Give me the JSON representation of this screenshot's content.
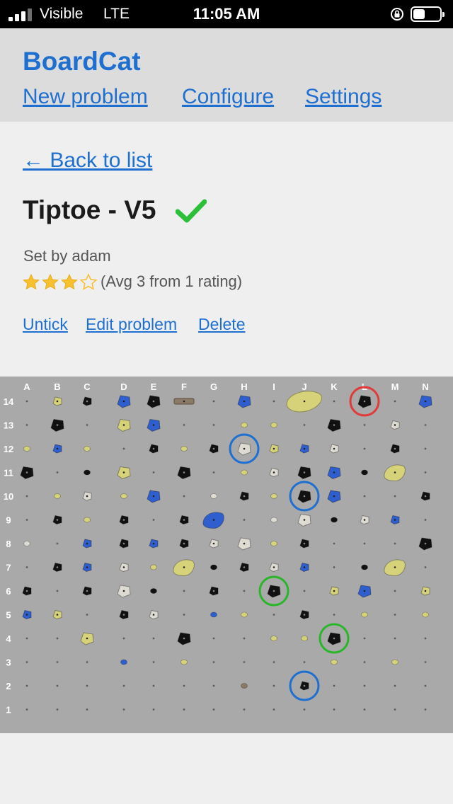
{
  "status_bar": {
    "carrier": "Visible",
    "network": "LTE",
    "time": "11:05 AM"
  },
  "header": {
    "brand": "BoardCat",
    "nav": [
      "New problem",
      "Configure",
      "Settings"
    ]
  },
  "back_link": "← Back to list",
  "problem": {
    "title": "Tiptoe - V5",
    "ticked": true,
    "set_by": "Set by adam",
    "stars_filled": 3,
    "stars_total": 4,
    "rating_text": "(Avg 3 from 1 rating)"
  },
  "actions": [
    "Untick",
    "Edit problem",
    "Delete"
  ],
  "colors": {
    "link": "#1e6fd0",
    "check": "#2bbf3a",
    "star": "#f6c02e",
    "board": "#a9a9a9",
    "hold_black": "#111111",
    "hold_yellow": "#d6d27a",
    "hold_blue": "#2f5fcf",
    "hold_white": "#dedbd2",
    "hold_wood": "#8a7a66",
    "circle_start": "#2bb52b",
    "circle_hand": "#1e6fd0",
    "circle_finish": "#e23a3a"
  },
  "board": {
    "columns": [
      "A",
      "B",
      "C",
      "D",
      "E",
      "F",
      "G",
      "H",
      "I",
      "J",
      "K",
      "L",
      "M",
      "N"
    ],
    "rows": [
      "14",
      "13",
      "12",
      "11",
      "10",
      "9",
      "8",
      "7",
      "6",
      "5",
      "4",
      "3",
      "2",
      "1"
    ],
    "holds": [
      {
        "c": "B",
        "r": 14,
        "k": "yellow",
        "s": "s"
      },
      {
        "c": "C",
        "r": 14,
        "k": "black",
        "s": "s"
      },
      {
        "c": "D",
        "r": 14,
        "k": "blue",
        "s": "m"
      },
      {
        "c": "E",
        "r": 14,
        "k": "black",
        "s": "m"
      },
      {
        "c": "F",
        "r": 14,
        "k": "wood",
        "s": "w"
      },
      {
        "c": "H",
        "r": 14,
        "k": "blue",
        "s": "m"
      },
      {
        "c": "J",
        "r": 14,
        "k": "yellow",
        "s": "xl"
      },
      {
        "c": "L",
        "r": 14,
        "k": "black",
        "s": "m"
      },
      {
        "c": "N",
        "r": 14,
        "k": "blue",
        "s": "m"
      },
      {
        "c": "B",
        "r": 13,
        "k": "black",
        "s": "m"
      },
      {
        "c": "D",
        "r": 13,
        "k": "yellow",
        "s": "m"
      },
      {
        "c": "E",
        "r": 13,
        "k": "blue",
        "s": "m"
      },
      {
        "c": "H",
        "r": 13,
        "k": "yellow",
        "s": "t"
      },
      {
        "c": "I",
        "r": 13,
        "k": "yellow",
        "s": "t"
      },
      {
        "c": "K",
        "r": 13,
        "k": "black",
        "s": "m"
      },
      {
        "c": "M",
        "r": 13,
        "k": "white",
        "s": "s"
      },
      {
        "c": "A",
        "r": 12,
        "k": "yellow",
        "s": "t"
      },
      {
        "c": "B",
        "r": 12,
        "k": "blue",
        "s": "s"
      },
      {
        "c": "C",
        "r": 12,
        "k": "yellow",
        "s": "t"
      },
      {
        "c": "E",
        "r": 12,
        "k": "black",
        "s": "s"
      },
      {
        "c": "F",
        "r": 12,
        "k": "yellow",
        "s": "t"
      },
      {
        "c": "G",
        "r": 12,
        "k": "black",
        "s": "s"
      },
      {
        "c": "H",
        "r": 12,
        "k": "white",
        "s": "m"
      },
      {
        "c": "I",
        "r": 12,
        "k": "yellow",
        "s": "s"
      },
      {
        "c": "J",
        "r": 12,
        "k": "blue",
        "s": "s"
      },
      {
        "c": "K",
        "r": 12,
        "k": "white",
        "s": "s"
      },
      {
        "c": "M",
        "r": 12,
        "k": "black",
        "s": "s"
      },
      {
        "c": "A",
        "r": 11,
        "k": "black",
        "s": "m"
      },
      {
        "c": "C",
        "r": 11,
        "k": "black",
        "s": "t"
      },
      {
        "c": "D",
        "r": 11,
        "k": "yellow",
        "s": "m"
      },
      {
        "c": "F",
        "r": 11,
        "k": "black",
        "s": "m"
      },
      {
        "c": "H",
        "r": 11,
        "k": "yellow",
        "s": "t"
      },
      {
        "c": "I",
        "r": 11,
        "k": "white",
        "s": "s"
      },
      {
        "c": "J",
        "r": 11,
        "k": "black",
        "s": "m"
      },
      {
        "c": "K",
        "r": 11,
        "k": "blue",
        "s": "m"
      },
      {
        "c": "L",
        "r": 11,
        "k": "black",
        "s": "t"
      },
      {
        "c": "M",
        "r": 11,
        "k": "yellow",
        "s": "l"
      },
      {
        "c": "B",
        "r": 10,
        "k": "yellow",
        "s": "t"
      },
      {
        "c": "C",
        "r": 10,
        "k": "white",
        "s": "s"
      },
      {
        "c": "D",
        "r": 10,
        "k": "yellow",
        "s": "t"
      },
      {
        "c": "E",
        "r": 10,
        "k": "blue",
        "s": "m"
      },
      {
        "c": "G",
        "r": 10,
        "k": "white",
        "s": "t"
      },
      {
        "c": "H",
        "r": 10,
        "k": "black",
        "s": "s"
      },
      {
        "c": "I",
        "r": 10,
        "k": "yellow",
        "s": "t"
      },
      {
        "c": "J",
        "r": 10,
        "k": "black",
        "s": "m"
      },
      {
        "c": "K",
        "r": 10,
        "k": "blue",
        "s": "m"
      },
      {
        "c": "N",
        "r": 10,
        "k": "black",
        "s": "s"
      },
      {
        "c": "B",
        "r": 9,
        "k": "black",
        "s": "s"
      },
      {
        "c": "C",
        "r": 9,
        "k": "yellow",
        "s": "t"
      },
      {
        "c": "D",
        "r": 9,
        "k": "black",
        "s": "s"
      },
      {
        "c": "F",
        "r": 9,
        "k": "black",
        "s": "s"
      },
      {
        "c": "G",
        "r": 9,
        "k": "blue",
        "s": "l"
      },
      {
        "c": "I",
        "r": 9,
        "k": "white",
        "s": "t"
      },
      {
        "c": "J",
        "r": 9,
        "k": "white",
        "s": "m"
      },
      {
        "c": "K",
        "r": 9,
        "k": "black",
        "s": "t"
      },
      {
        "c": "L",
        "r": 9,
        "k": "white",
        "s": "s"
      },
      {
        "c": "M",
        "r": 9,
        "k": "blue",
        "s": "s"
      },
      {
        "c": "A",
        "r": 8,
        "k": "white",
        "s": "t"
      },
      {
        "c": "C",
        "r": 8,
        "k": "blue",
        "s": "s"
      },
      {
        "c": "D",
        "r": 8,
        "k": "black",
        "s": "s"
      },
      {
        "c": "E",
        "r": 8,
        "k": "blue",
        "s": "s"
      },
      {
        "c": "F",
        "r": 8,
        "k": "black",
        "s": "s"
      },
      {
        "c": "G",
        "r": 8,
        "k": "white",
        "s": "s"
      },
      {
        "c": "H",
        "r": 8,
        "k": "white",
        "s": "m"
      },
      {
        "c": "I",
        "r": 8,
        "k": "yellow",
        "s": "t"
      },
      {
        "c": "J",
        "r": 8,
        "k": "black",
        "s": "s"
      },
      {
        "c": "N",
        "r": 8,
        "k": "black",
        "s": "m"
      },
      {
        "c": "B",
        "r": 7,
        "k": "black",
        "s": "s"
      },
      {
        "c": "C",
        "r": 7,
        "k": "blue",
        "s": "s"
      },
      {
        "c": "D",
        "r": 7,
        "k": "white",
        "s": "s"
      },
      {
        "c": "E",
        "r": 7,
        "k": "yellow",
        "s": "t"
      },
      {
        "c": "F",
        "r": 7,
        "k": "yellow",
        "s": "l"
      },
      {
        "c": "G",
        "r": 7,
        "k": "black",
        "s": "t"
      },
      {
        "c": "H",
        "r": 7,
        "k": "black",
        "s": "s"
      },
      {
        "c": "I",
        "r": 7,
        "k": "white",
        "s": "s"
      },
      {
        "c": "J",
        "r": 7,
        "k": "blue",
        "s": "s"
      },
      {
        "c": "L",
        "r": 7,
        "k": "black",
        "s": "t"
      },
      {
        "c": "M",
        "r": 7,
        "k": "yellow",
        "s": "l"
      },
      {
        "c": "A",
        "r": 6,
        "k": "black",
        "s": "s"
      },
      {
        "c": "C",
        "r": 6,
        "k": "black",
        "s": "s"
      },
      {
        "c": "D",
        "r": 6,
        "k": "white",
        "s": "m"
      },
      {
        "c": "E",
        "r": 6,
        "k": "black",
        "s": "t"
      },
      {
        "c": "G",
        "r": 6,
        "k": "black",
        "s": "s"
      },
      {
        "c": "I",
        "r": 6,
        "k": "black",
        "s": "m"
      },
      {
        "c": "K",
        "r": 6,
        "k": "yellow",
        "s": "s"
      },
      {
        "c": "L",
        "r": 6,
        "k": "blue",
        "s": "m"
      },
      {
        "c": "N",
        "r": 6,
        "k": "yellow",
        "s": "s"
      },
      {
        "c": "A",
        "r": 5,
        "k": "blue",
        "s": "s"
      },
      {
        "c": "B",
        "r": 5,
        "k": "yellow",
        "s": "s"
      },
      {
        "c": "D",
        "r": 5,
        "k": "black",
        "s": "s"
      },
      {
        "c": "E",
        "r": 5,
        "k": "white",
        "s": "s"
      },
      {
        "c": "G",
        "r": 5,
        "k": "blue",
        "s": "t"
      },
      {
        "c": "H",
        "r": 5,
        "k": "yellow",
        "s": "t"
      },
      {
        "c": "J",
        "r": 5,
        "k": "black",
        "s": "s"
      },
      {
        "c": "L",
        "r": 5,
        "k": "yellow",
        "s": "t"
      },
      {
        "c": "N",
        "r": 5,
        "k": "yellow",
        "s": "t"
      },
      {
        "c": "C",
        "r": 4,
        "k": "yellow",
        "s": "m"
      },
      {
        "c": "F",
        "r": 4,
        "k": "black",
        "s": "m"
      },
      {
        "c": "I",
        "r": 4,
        "k": "yellow",
        "s": "t"
      },
      {
        "c": "J",
        "r": 4,
        "k": "yellow",
        "s": "t"
      },
      {
        "c": "K",
        "r": 4,
        "k": "black",
        "s": "m"
      },
      {
        "c": "D",
        "r": 3,
        "k": "blue",
        "s": "t"
      },
      {
        "c": "F",
        "r": 3,
        "k": "yellow",
        "s": "t"
      },
      {
        "c": "K",
        "r": 3,
        "k": "yellow",
        "s": "t"
      },
      {
        "c": "M",
        "r": 3,
        "k": "yellow",
        "s": "t"
      },
      {
        "c": "H",
        "r": 2,
        "k": "wood",
        "s": "t"
      },
      {
        "c": "J",
        "r": 2,
        "k": "black",
        "s": "s"
      }
    ],
    "circled": [
      {
        "c": "L",
        "r": 14,
        "role": "finish"
      },
      {
        "c": "H",
        "r": 12,
        "role": "hand"
      },
      {
        "c": "J",
        "r": 10,
        "role": "hand"
      },
      {
        "c": "I",
        "r": 6,
        "role": "start"
      },
      {
        "c": "K",
        "r": 4,
        "role": "start"
      },
      {
        "c": "J",
        "r": 2,
        "role": "hand"
      }
    ]
  }
}
